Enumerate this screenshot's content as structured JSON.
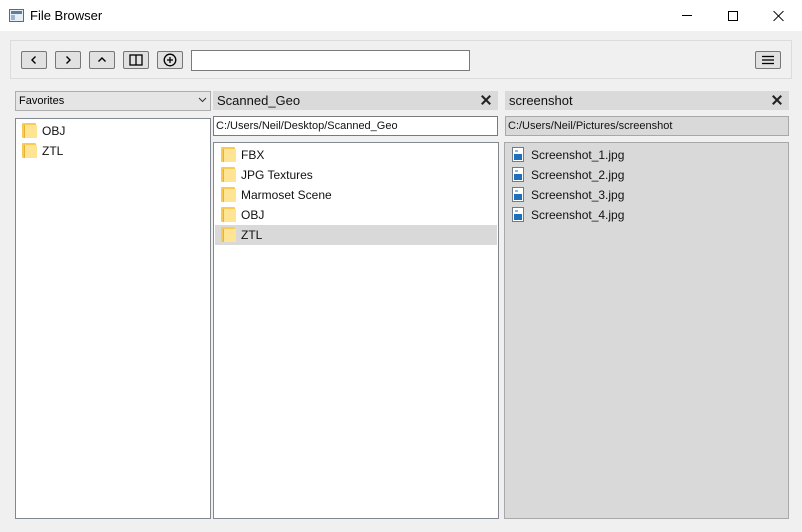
{
  "window": {
    "title": "File Browser"
  },
  "toolbar": {
    "back_icon": "chevron-left-icon",
    "forward_icon": "chevron-right-icon",
    "up_icon": "chevron-up-icon",
    "split_icon": "split-view-icon",
    "add_icon": "plus-circle-icon",
    "menu_icon": "hamburger-icon",
    "path_value": ""
  },
  "favorites": {
    "selected": "Favorites",
    "items": [
      {
        "label": "OBJ",
        "icon": "folder-icon"
      },
      {
        "label": "ZTL",
        "icon": "folder-icon"
      }
    ]
  },
  "pane_scanned": {
    "title": "Scanned_Geo",
    "path": "C:/Users/Neil/Desktop/Scanned_Geo",
    "items": [
      {
        "label": "FBX",
        "icon": "folder-icon"
      },
      {
        "label": "JPG Textures",
        "icon": "folder-icon"
      },
      {
        "label": "Marmoset Scene",
        "icon": "folder-icon"
      },
      {
        "label": "OBJ",
        "icon": "folder-icon"
      },
      {
        "label": "ZTL",
        "icon": "folder-icon",
        "selected": true
      }
    ]
  },
  "pane_screenshot": {
    "title": "screenshot",
    "path": "C:/Users/Neil/Pictures/screenshot",
    "items": [
      {
        "label": "Screenshot_1.jpg",
        "icon": "image-file-icon"
      },
      {
        "label": "Screenshot_2.jpg",
        "icon": "image-file-icon"
      },
      {
        "label": "Screenshot_3.jpg",
        "icon": "image-file-icon"
      },
      {
        "label": "Screenshot_4.jpg",
        "icon": "image-file-icon"
      }
    ]
  }
}
